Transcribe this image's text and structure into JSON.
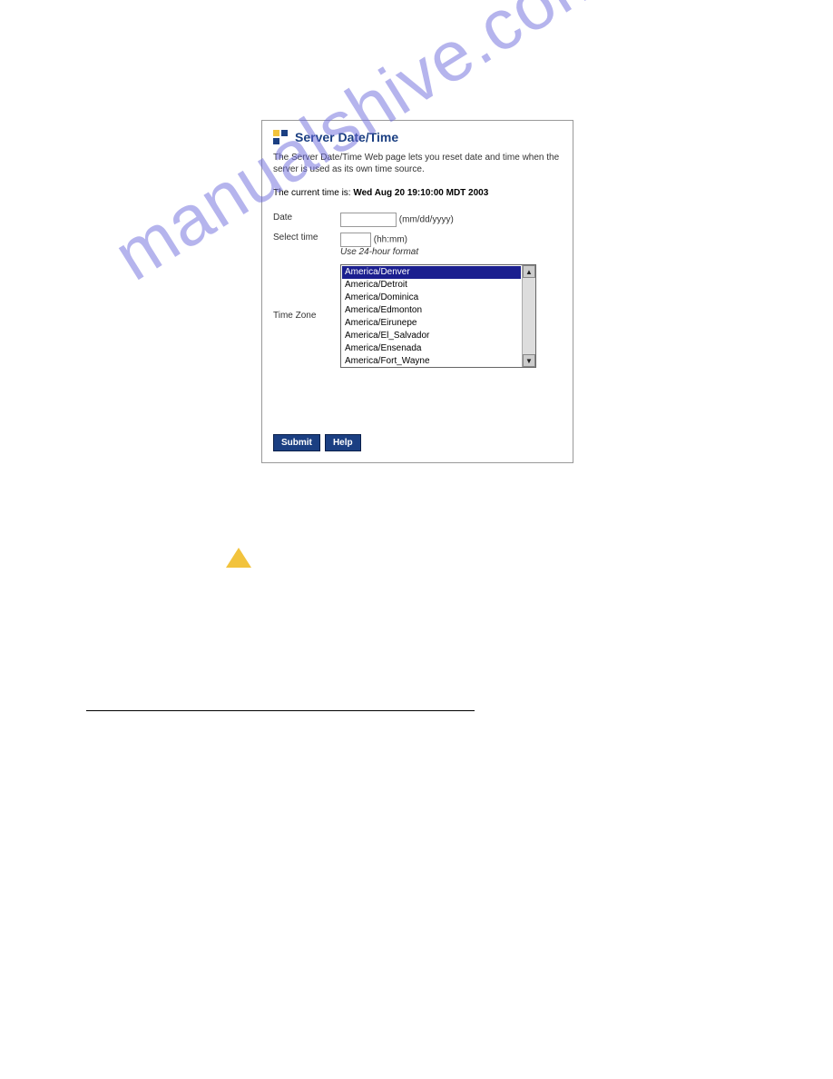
{
  "panel": {
    "title": "Server Date/Time",
    "description": "The Server Date/Time Web page lets you reset date and time when the server is used as its own time source.",
    "current_label": "The current time is: ",
    "current_value": "Wed Aug 20 19:10:00 MDT 2003",
    "date": {
      "label": "Date",
      "value": "",
      "hint": "(mm/dd/yyyy)"
    },
    "time": {
      "label": "Select time",
      "value": "",
      "hint": "(hh:mm)",
      "format_note": "Use 24-hour format"
    },
    "tz": {
      "label": "Time Zone",
      "options": [
        "America/Denver",
        "America/Detroit",
        "America/Dominica",
        "America/Edmonton",
        "America/Eirunepe",
        "America/El_Salvador",
        "America/Ensenada",
        "America/Fort_Wayne"
      ],
      "selected_index": 0
    },
    "buttons": {
      "submit": "Submit",
      "help": "Help"
    }
  },
  "watermark": "manualshive.com"
}
